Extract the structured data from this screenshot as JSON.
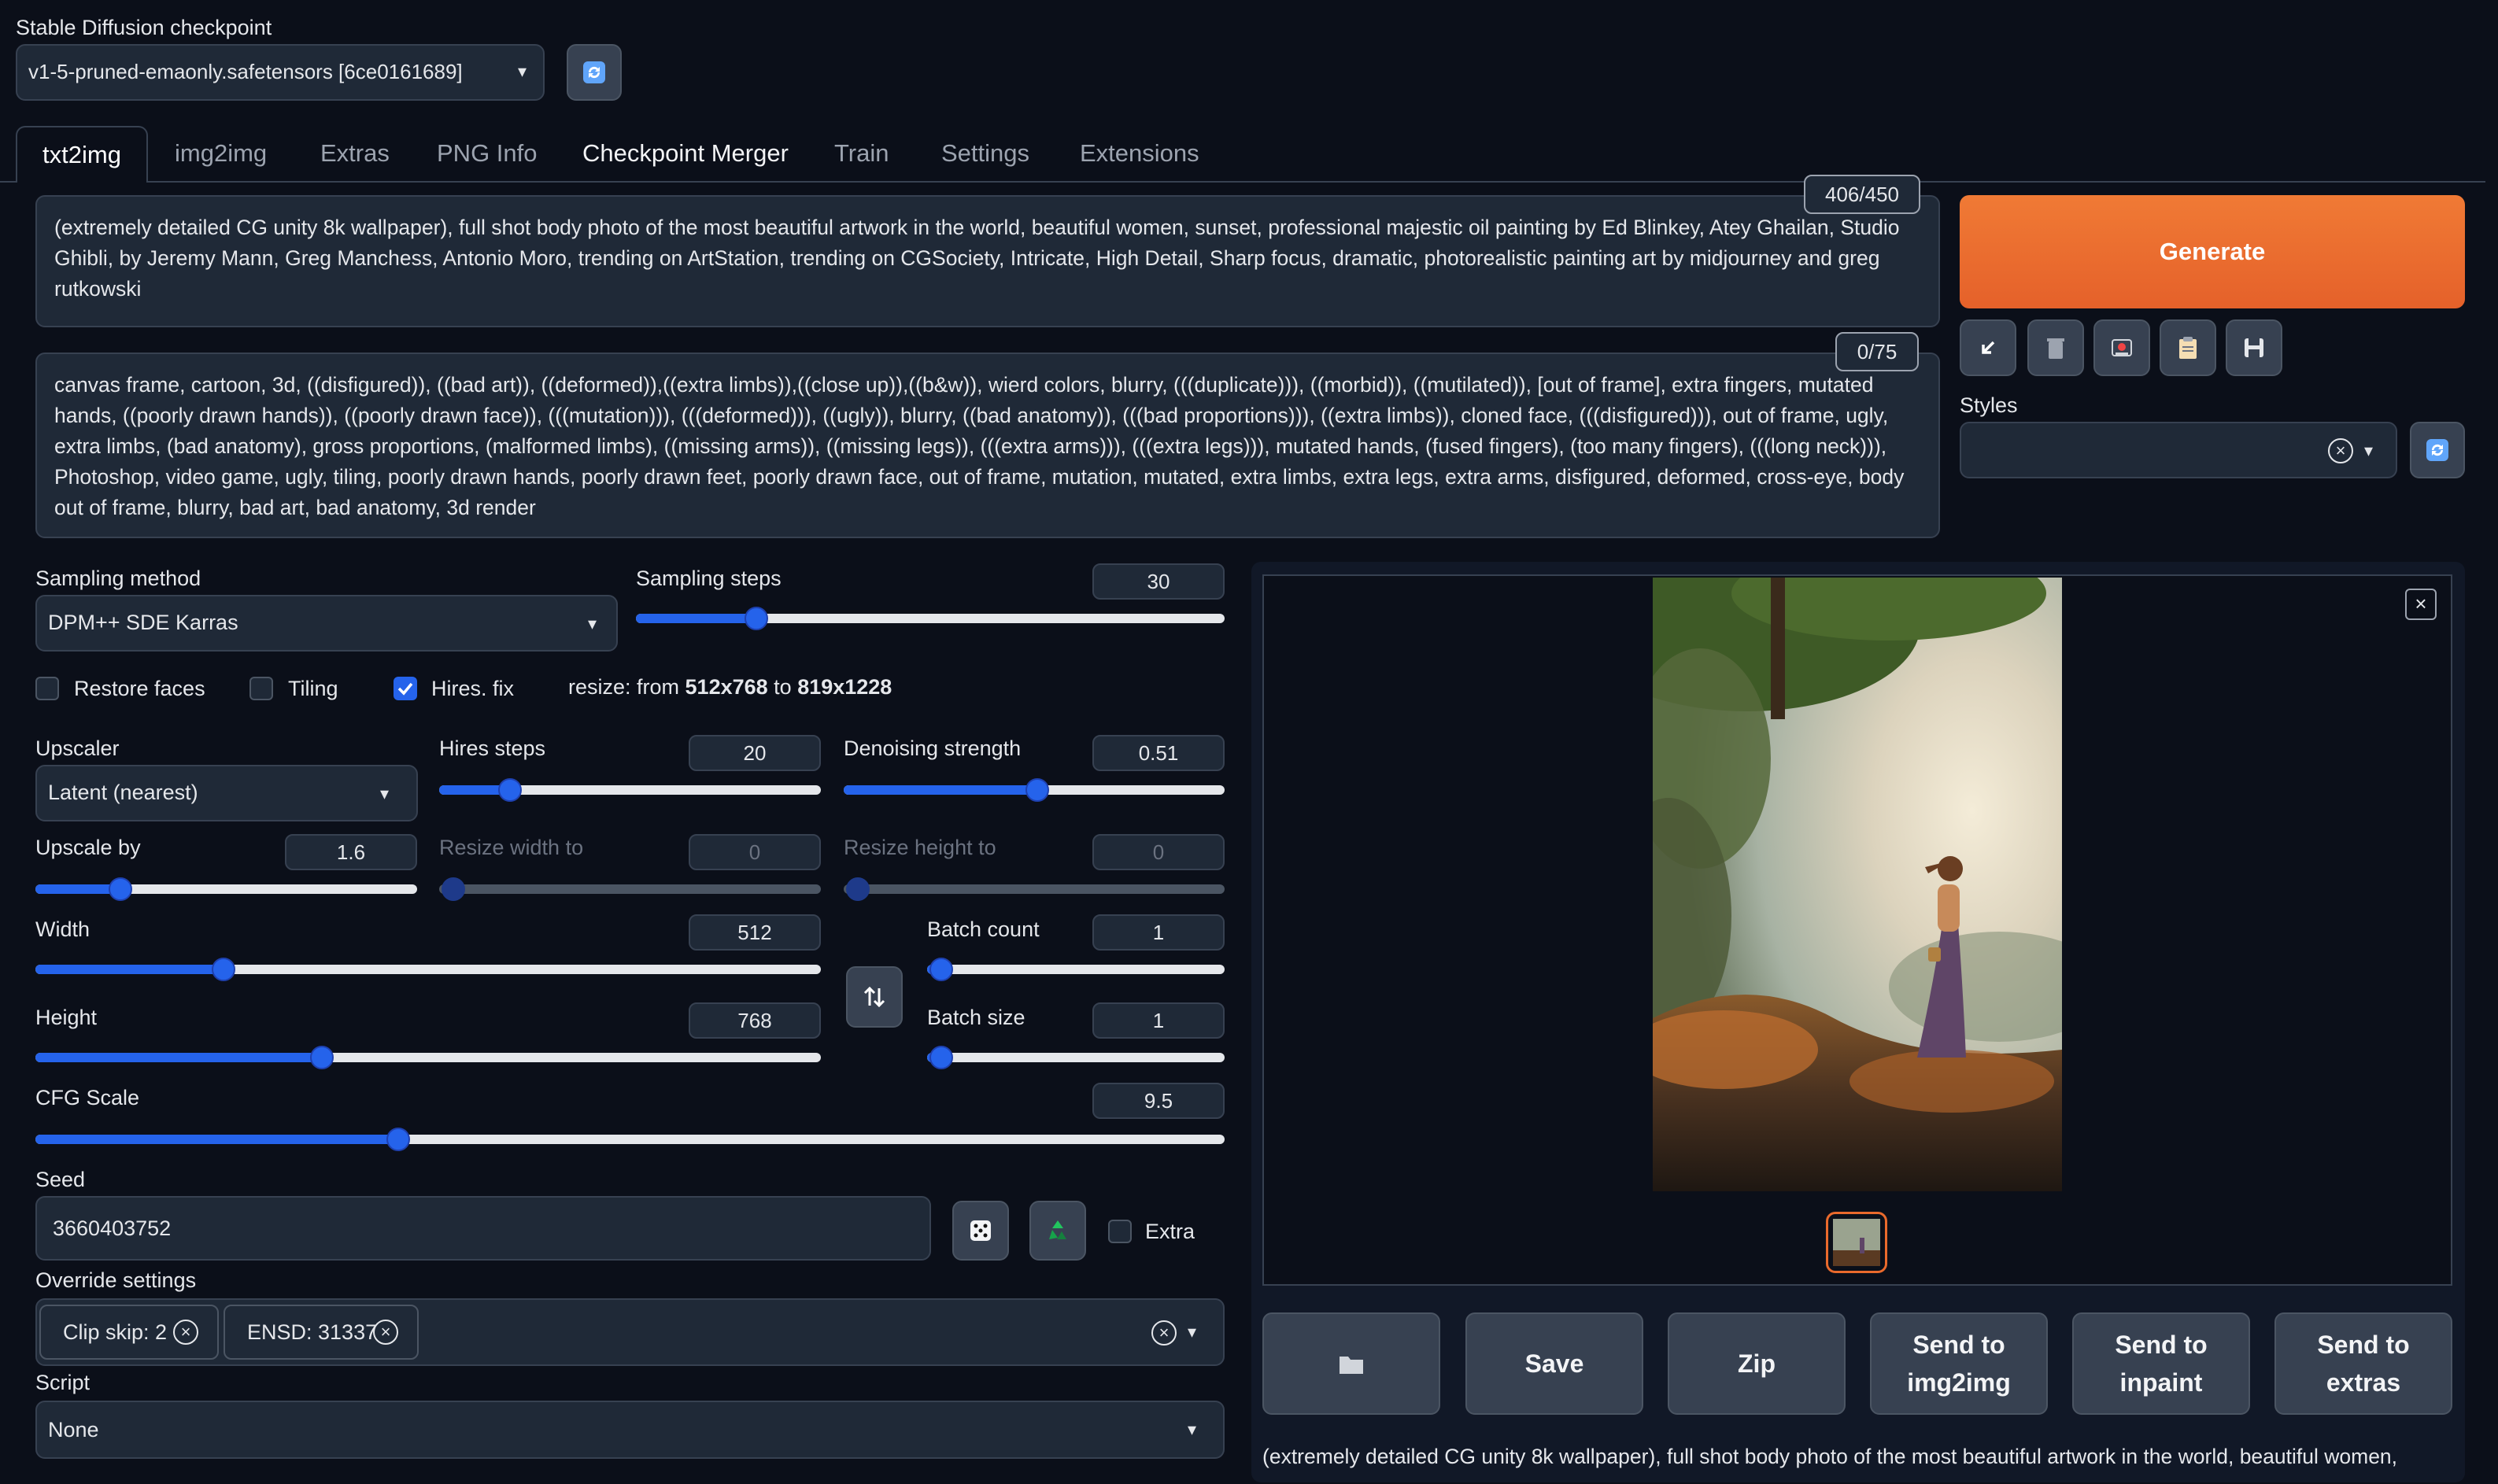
{
  "checkpoint": {
    "label": "Stable Diffusion checkpoint",
    "value": "v1-5-pruned-emaonly.safetensors [6ce0161689]"
  },
  "tabs": [
    "txt2img",
    "img2img",
    "Extras",
    "PNG Info",
    "Checkpoint Merger",
    "Train",
    "Settings",
    "Extensions"
  ],
  "prompt": {
    "text": "(extremely detailed CG unity 8k wallpaper), full shot body photo of the most beautiful artwork in the world, beautiful women, sunset, professional majestic oil painting by Ed Blinkey, Atey Ghailan, Studio Ghibli, by Jeremy Mann, Greg Manchess, Antonio Moro, trending on ArtStation, trending on CGSociety, Intricate, High Detail, Sharp focus, dramatic, photorealistic painting art by midjourney and greg rutkowski",
    "counter": "406/450"
  },
  "negative_prompt": {
    "text": "canvas frame, cartoon, 3d, ((disfigured)), ((bad art)), ((deformed)),((extra limbs)),((close up)),((b&w)), wierd colors, blurry, (((duplicate))), ((morbid)), ((mutilated)), [out of frame], extra fingers, mutated hands, ((poorly drawn hands)), ((poorly drawn face)), (((mutation))), (((deformed))), ((ugly)), blurry, ((bad anatomy)), (((bad proportions))), ((extra limbs)), cloned face, (((disfigured))), out of frame, ugly, extra limbs, (bad anatomy), gross proportions, (malformed limbs), ((missing arms)), ((missing legs)), (((extra arms))), (((extra legs))), mutated hands, (fused fingers), (too many fingers), (((long neck))), Photoshop, video game, ugly, tiling, poorly drawn hands, poorly drawn feet, poorly drawn face, out of frame, mutation, mutated, extra limbs, extra legs, extra arms, disfigured, deformed, cross-eye, body out of frame, blurry, bad art, bad anatomy, 3d render",
    "counter": "0/75"
  },
  "generate_label": "Generate",
  "styles": {
    "label": "Styles",
    "value": ""
  },
  "sampling": {
    "method_label": "Sampling method",
    "method": "DPM++ SDE Karras",
    "steps_label": "Sampling steps",
    "steps": "30",
    "steps_fraction": 0.19
  },
  "checks": {
    "restore_faces": "Restore faces",
    "tiling": "Tiling",
    "hires_fix": "Hires. fix"
  },
  "resize_note": {
    "prefix": "resize: from ",
    "from": "512x768",
    "mid": " to ",
    "to": "819x1228"
  },
  "hires": {
    "upscaler_label": "Upscaler",
    "upscaler": "Latent (nearest)",
    "steps_label": "Hires steps",
    "steps": "20",
    "steps_fraction": 0.16,
    "denoise_label": "Denoising strength",
    "denoise": "0.51",
    "denoise_fraction": 0.51,
    "upscale_label": "Upscale by",
    "upscale": "1.6",
    "upscale_fraction": 0.2,
    "rw_label": "Resize width to",
    "rw": "0",
    "rh_label": "Resize height to",
    "rh": "0"
  },
  "size": {
    "width_label": "Width",
    "width": "512",
    "width_fraction": 0.23,
    "height_label": "Height",
    "height": "768",
    "height_fraction": 0.36,
    "batch_count_label": "Batch count",
    "batch_count": "1",
    "batch_count_fraction": 0.0,
    "batch_size_label": "Batch size",
    "batch_size": "1",
    "batch_size_fraction": 0.0
  },
  "cfg": {
    "label": "CFG Scale",
    "value": "9.5",
    "fraction": 0.3
  },
  "seed": {
    "label": "Seed",
    "value": "3660403752",
    "extra_label": "Extra"
  },
  "override": {
    "label": "Override settings",
    "chips": [
      "Clip skip: 2",
      "ENSD: 31337"
    ]
  },
  "script": {
    "label": "Script",
    "value": "None"
  },
  "output_buttons": {
    "save": "Save",
    "zip": "Zip",
    "send_img2img": [
      "Send to",
      "img2img"
    ],
    "send_inpaint": [
      "Send to",
      "inpaint"
    ],
    "send_extras": [
      "Send to",
      "extras"
    ]
  },
  "info_text": "(extremely detailed CG unity 8k wallpaper), full shot body photo of the most beautiful artwork in the world, beautiful women,",
  "colors": {
    "background": "#0b0f19",
    "panel": "#1f2937",
    "accent_blue": "#2563eb",
    "generate_orange": "#ea6a2c"
  }
}
